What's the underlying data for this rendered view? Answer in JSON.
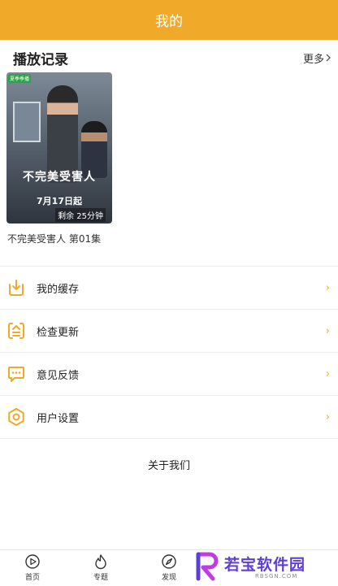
{
  "header": {
    "title": "我的"
  },
  "history": {
    "title": "播放记录",
    "more_label": "更多",
    "item": {
      "poster_tag": "夏季季播",
      "poster_title": "不完美受害人",
      "poster_date": "7月17日起",
      "remaining": "剩余 25分钟",
      "caption": "不完美受害人 第01集"
    }
  },
  "menu": [
    {
      "label": "我的缓存",
      "icon": "download-icon"
    },
    {
      "label": "检查更新",
      "icon": "update-icon"
    },
    {
      "label": "意见反馈",
      "icon": "feedback-icon"
    },
    {
      "label": "用户设置",
      "icon": "settings-icon"
    }
  ],
  "about_label": "关于我们",
  "tabs": [
    {
      "label": "首页",
      "icon": "play-circle-icon"
    },
    {
      "label": "专题",
      "icon": "flame-icon"
    },
    {
      "label": "发现",
      "icon": "compass-icon"
    }
  ],
  "watermark": {
    "text": "若宝软件园",
    "subtext": "RBSGN.COM"
  },
  "colors": {
    "accent": "#f0a929",
    "watermark": "#5b3fd6"
  }
}
